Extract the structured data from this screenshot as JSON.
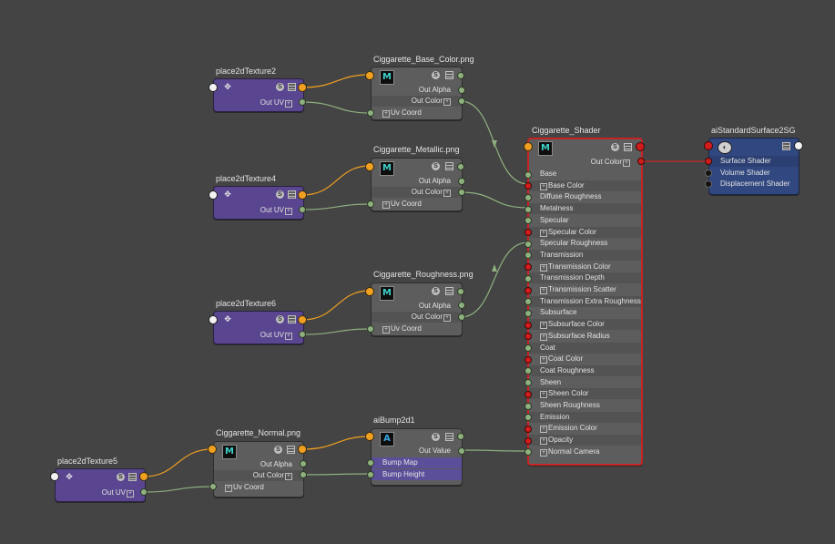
{
  "titles": {
    "place2dTexture2": "place2dTexture2",
    "base_color": "Ciggarette_Base_Color.png",
    "place2dTexture4": "place2dTexture4",
    "metallic": "Ciggarette_Metallic.png",
    "place2dTexture6": "place2dTexture6",
    "roughness": "Ciggarette_Roughness.png",
    "normal": "Ciggarette_Normal.png",
    "aibump": "aiBump2d1",
    "place2dTexture5": "place2dTexture5",
    "shader": "Ciggarette_Shader",
    "sg": "aiStandardSurface2SG"
  },
  "labels": {
    "out_uv": "Out UV",
    "out_alpha": "Out Alpha",
    "out_color": "Out Color",
    "uv_coord": "Uv Coord",
    "out_value": "Out Value",
    "bump_map": "Bump Map",
    "bump_height": "Bump Height",
    "surface_shader": "Surface Shader",
    "volume_shader": "Volume Shader",
    "displacement_shader": "Displacement Shader",
    "swatch_letter_m": "M",
    "swatch_letter_a": "A",
    "s_badge": "S"
  },
  "shader_attrs": [
    "Base",
    "Base Color",
    "Diffuse Roughness",
    "Metalness",
    "Specular",
    "Specular Color",
    "Specular Roughness",
    "Transmission",
    "Transmission Color",
    "Transmission Depth",
    "Transmission Scatter",
    "Transmission Extra Roughness",
    "Subsurface",
    "Subsurface Color",
    "Subsurface Radius",
    "Coat",
    "Coat Color",
    "Coat Roughness",
    "Sheen",
    "Sheen Color",
    "Sheen Roughness",
    "Emission",
    "Emission Color",
    "Opacity",
    "Normal Camera"
  ],
  "colors": {
    "background": "#444444",
    "utility_node": "#5a4690",
    "texture_node": "#5d5d5d",
    "shading_group": "#31477f",
    "selection_border": "#c62424",
    "wire_uv": "#8fb07f",
    "wire_color_out": "#f0a020",
    "wire_shader": "#c62424"
  }
}
